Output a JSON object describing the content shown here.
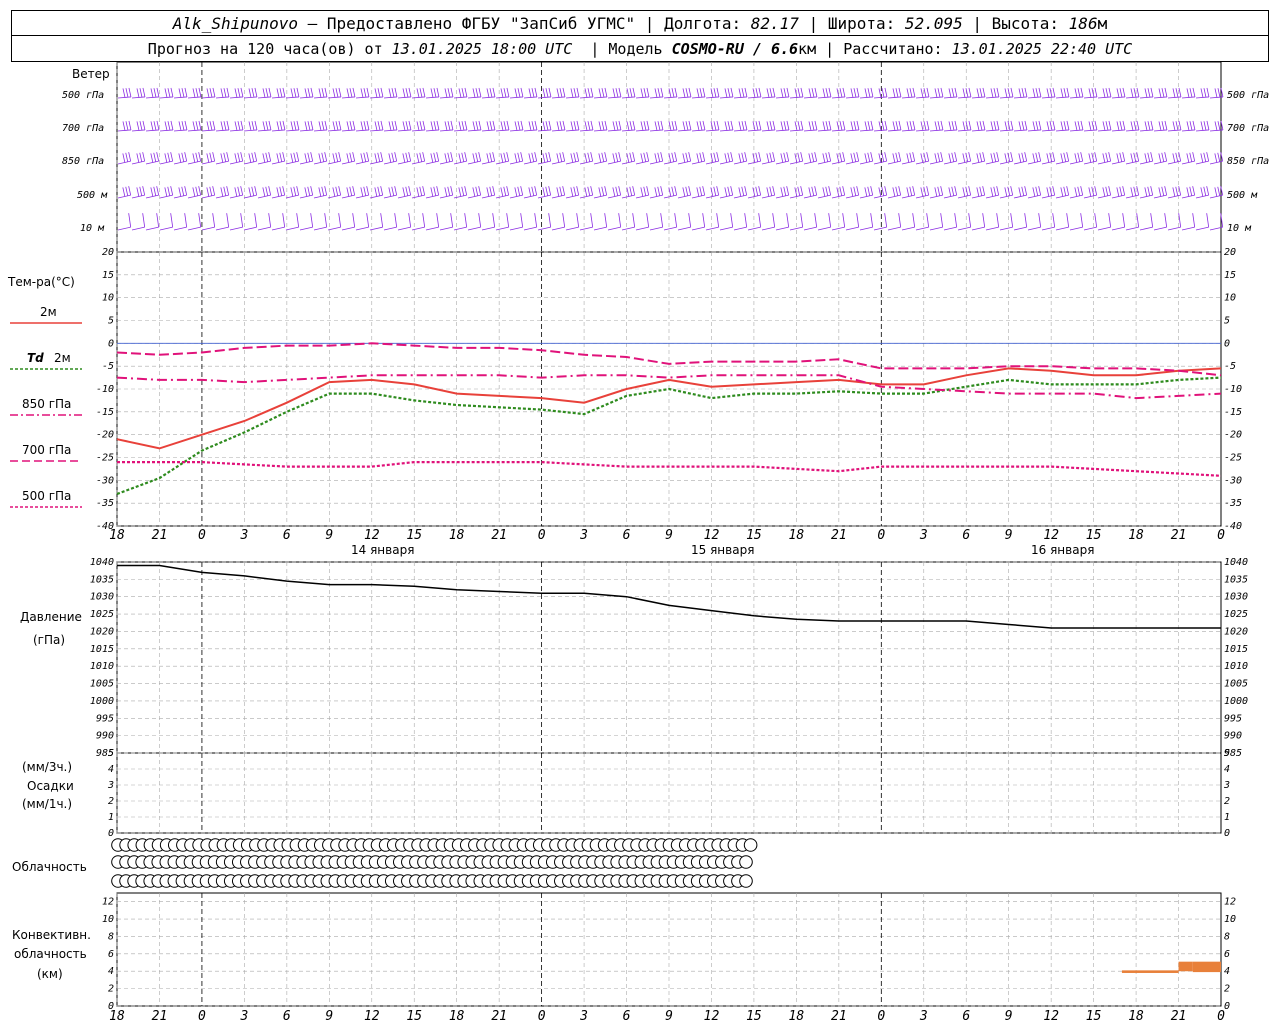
{
  "header": {
    "station": "Alk_Shipunovo",
    "provider": " – Предоставлено ФГБУ \"ЗапСиб УГМС\" | Долгота: ",
    "lon": "82.17",
    "lat_label": " | Широта: ",
    "lat": "52.095",
    "alt_label": " | Высота: ",
    "alt": "186",
    "alt_unit": "м",
    "forecast_label": "Прогноз на 120 часа(ов) от ",
    "forecast_start": "13.01.2025 18:00 UTC",
    "model_label": "  | Модель ",
    "model": "COSMO-RU / 6.6",
    "model_unit": "км",
    "calc_label": " | Рассчитано: ",
    "calc_time": "13.01.2025 22:40 UTC"
  },
  "wind_panel": {
    "title": "Ветер",
    "levels": [
      "500 гПа",
      "700 гПа",
      "850 гПа",
      "500 м",
      "10 м"
    ]
  },
  "temp_panel": {
    "title": "Тем-ра(°С)",
    "legend": [
      {
        "label": "2м",
        "color": "#e8413a"
      },
      {
        "label": "Td",
        "label2": "2м",
        "color": "#2e8b1e"
      },
      {
        "label": "850 гПа",
        "color": "#e0127a"
      },
      {
        "label": "700 гПа",
        "color": "#e0127a"
      },
      {
        "label": "500 гПа",
        "color": "#e0127a"
      }
    ],
    "ticks": [
      "20",
      "15",
      "10",
      "5",
      "0",
      "-5",
      "-10",
      "-15",
      "-20",
      "-25",
      "-30",
      "-35",
      "-40"
    ]
  },
  "time_axis": {
    "hours": [
      "18",
      "21",
      "0",
      "3",
      "6",
      "9",
      "12",
      "15",
      "18",
      "21",
      "0",
      "3",
      "6",
      "9",
      "12",
      "15",
      "18",
      "21",
      "0",
      "3",
      "6",
      "9",
      "12",
      "15",
      "18",
      "21",
      "0"
    ],
    "dates": [
      "14 января",
      "15 января",
      "16 января"
    ]
  },
  "pressure_panel": {
    "title": "Давление",
    "unit": "(гПа)",
    "ticks": [
      "1040",
      "1035",
      "1030",
      "1025",
      "1020",
      "1015",
      "1010",
      "1005",
      "1000",
      "995",
      "990",
      "985"
    ]
  },
  "precip_panel": {
    "unit1": "(мм/3ч.)",
    "title": "Осадки",
    "unit2": "(мм/1ч.)",
    "ticks": [
      "5",
      "4",
      "3",
      "2",
      "1",
      "0"
    ]
  },
  "cloud_panel": {
    "title": "Облачность"
  },
  "conv_panel": {
    "title1": "Конвективн.",
    "title2": "облачность",
    "unit": "(км)",
    "ticks": [
      "12",
      "10",
      "8",
      "6",
      "4",
      "2",
      "0"
    ]
  },
  "chart_data": [
    {
      "type": "line",
      "title": "Тем-ра(°С)",
      "x_hours": [
        0,
        3,
        6,
        9,
        12,
        15,
        18,
        21,
        24,
        27,
        30,
        33,
        36,
        39,
        42,
        45,
        48,
        51,
        54,
        57,
        60,
        63,
        66,
        69,
        72,
        75,
        78
      ],
      "ylim": [
        -40,
        20
      ],
      "series": [
        {
          "name": "2м",
          "color": "#e8413a",
          "values": [
            -21,
            -23,
            -20,
            -17,
            -13,
            -8.5,
            -8,
            -9,
            -11,
            -11.5,
            -12,
            -13,
            -10,
            -8,
            -9.5,
            -9,
            -8.5,
            -8,
            -9,
            -9,
            -7,
            -5.5,
            -6,
            -7,
            -7,
            -6,
            -5.5
          ]
        },
        {
          "name": "Td 2м",
          "color": "#2e8b1e",
          "values": [
            -33,
            -29.5,
            -23.5,
            -19.5,
            -15,
            -11,
            -11,
            -12.5,
            -13.5,
            -14,
            -14.5,
            -15.5,
            -11.5,
            -10,
            -12,
            -11,
            -11,
            -10.5,
            -11,
            -11,
            -9.5,
            -8,
            -9,
            -9,
            -9,
            -8,
            -7.5
          ]
        },
        {
          "name": "850 гПа",
          "color": "#e0127a",
          "values": [
            -2,
            -2.5,
            -2,
            -1,
            -0.5,
            -0.5,
            0,
            -0.5,
            -1,
            -1,
            -1.5,
            -2.5,
            -3,
            -4.5,
            -4,
            -4,
            -4,
            -3.5,
            -5.5,
            -5.5,
            -5.5,
            -5,
            -5,
            -5.5,
            -5.5,
            -6,
            -7
          ]
        },
        {
          "name": "700 гПа",
          "color": "#e0127a",
          "values": [
            -7.5,
            -8,
            -8,
            -8.5,
            -8,
            -7.5,
            -7,
            -7,
            -7,
            -7,
            -7.5,
            -7,
            -7,
            -7.5,
            -7,
            -7,
            -7,
            -7,
            -9.5,
            -10,
            -10.5,
            -11,
            -11,
            -11,
            -12,
            -11.5,
            -11
          ]
        },
        {
          "name": "500 гПа",
          "color": "#e0127a",
          "values": [
            -26,
            -26,
            -26,
            -26.5,
            -27,
            -27,
            -27,
            -26,
            -26,
            -26,
            -26,
            -26.5,
            -27,
            -27,
            -27,
            -27,
            -27.5,
            -28,
            -27,
            -27,
            -27,
            -27,
            -27,
            -27.5,
            -28,
            -28.5,
            -29
          ]
        }
      ]
    },
    {
      "type": "line",
      "title": "Давление",
      "ylabel": "(гПа)",
      "x_hours": [
        0,
        3,
        6,
        9,
        12,
        15,
        18,
        21,
        24,
        27,
        30,
        33,
        36,
        39,
        42,
        45,
        48,
        51,
        54,
        57,
        60,
        63,
        66,
        69,
        72,
        75,
        78
      ],
      "ylim": [
        985,
        1040
      ],
      "series": [
        {
          "name": "Давление",
          "color": "#000000",
          "values": [
            1039,
            1039,
            1037,
            1036,
            1034.5,
            1033.5,
            1033.5,
            1033,
            1032,
            1031.5,
            1031,
            1031,
            1030,
            1027.5,
            1026,
            1024.5,
            1023.5,
            1023,
            1023,
            1023,
            1023,
            1022,
            1021,
            1021,
            1021,
            1021,
            1021
          ]
        }
      ]
    },
    {
      "type": "bar",
      "title": "Осадки",
      "ylim": [
        0,
        5
      ],
      "series": [
        {
          "name": "Осадки",
          "values": []
        }
      ]
    },
    {
      "type": "bar",
      "title": "Конвективн. облачность",
      "ylabel": "(км)",
      "ylim": [
        0,
        13
      ],
      "series": [
        {
          "name": "Конвективн. облачность",
          "color": "#e8803a",
          "segments": [
            {
              "from": 71,
              "to": 75,
              "bottom": 3.8,
              "top": 4.1
            },
            {
              "from": 75,
              "to": 76,
              "bottom": 4.0,
              "top": 5.1
            },
            {
              "from": 76,
              "to": 78,
              "bottom": 3.9,
              "top": 5.1
            }
          ]
        }
      ]
    }
  ],
  "cloud_rows": [
    "AAAAAAAAAAAAAAAAAAAAAAAAAAAAAAAAAAAAAAAAAAAAAAAAAAAAAAAAAAAAAAAAAAAAAAAAAAAAAAAAAAAAAAAAAAAAAAAAAAAABCADCCCCDCBCDDDDCDDDDDDDCDDDDDDDCCBDD",
    "AAAAAAAAAAAAAAAAAAAAAAAAAAAAAAAAAAAAAAAAAAAAAAAAAAAAAAAAAAAAAAAAAAAAAAAAAAAAAAAAAAAAAAAAAAAAAAAAAAAAAAAAAAAAAAAAAAAAAAAAACCCAAACAAACDDDDDD",
    "AAAAAAAAAAAAAAAAAAAAAAAAAAAAAAAAAAAAAAAAAAAAAAAAAAAAAAAAAAAAAAAAAAAAAAAAAAAAAAAAAAAAAAAAAAAAAAAAAAAAAAAAAAAAAAAAAAAAAAAAAAAAAAAAAAAAAAADDD"
  ],
  "colors": {
    "wind": "#8a2be2",
    "grid": "#999999",
    "zero_line": "#4060d0"
  }
}
